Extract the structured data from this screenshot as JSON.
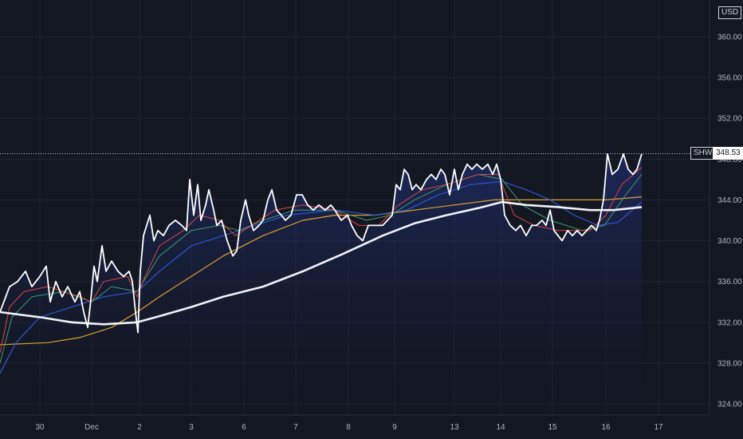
{
  "currency_label": "USD",
  "symbol": "SHW",
  "last_price": "348.53",
  "colors": {
    "background": "#131722",
    "grid": "#1f2433",
    "price_line": "#ffffff",
    "ma_long": "#f0f2f7",
    "ma_gold": "#e0a12e",
    "ma_blue": "#2e56d6",
    "ma_green": "#3f9a73",
    "ma_red": "#d9473c",
    "fill_bottom": "#1a2a63"
  },
  "chart_data": {
    "type": "line",
    "x_ticks": [
      "30",
      "Dec",
      "2",
      "3",
      "6",
      "7",
      "8",
      "9",
      "13",
      "14",
      "15",
      "16",
      "17"
    ],
    "y_ticks": [
      "360.00",
      "356.00",
      "352.00",
      "348.00",
      "344.00",
      "340.00",
      "336.00",
      "332.00",
      "328.00",
      "324.00"
    ],
    "ylim": [
      323,
      363.5
    ],
    "grid": true,
    "series": [
      {
        "role": "price",
        "values": [
          [
            0,
            333.0
          ],
          [
            12,
            335.5
          ],
          [
            22,
            336.0
          ],
          [
            32,
            337.0
          ],
          [
            40,
            335.5
          ],
          [
            50,
            336.5
          ],
          [
            58,
            337.5
          ],
          [
            63,
            334.0
          ],
          [
            70,
            336.0
          ],
          [
            78,
            334.5
          ],
          [
            85,
            335.5
          ],
          [
            94,
            334.0
          ],
          [
            100,
            335.0
          ],
          [
            105,
            333.0
          ],
          [
            110,
            331.5
          ],
          [
            113,
            333.5
          ],
          [
            118,
            337.5
          ],
          [
            122,
            336.0
          ],
          [
            128,
            339.5
          ],
          [
            133,
            337.0
          ],
          [
            140,
            338.0
          ],
          [
            148,
            337.0
          ],
          [
            155,
            336.5
          ],
          [
            162,
            337.0
          ],
          [
            166,
            336.0
          ],
          [
            170,
            333.0
          ],
          [
            173,
            331.0
          ],
          [
            176,
            337.0
          ],
          [
            180,
            340.5
          ],
          [
            184,
            341.5
          ],
          [
            188,
            342.5
          ],
          [
            193,
            340.0
          ],
          [
            198,
            341.0
          ],
          [
            205,
            340.5
          ],
          [
            212,
            341.5
          ],
          [
            220,
            342.0
          ],
          [
            228,
            341.5
          ],
          [
            234,
            341.0
          ],
          [
            238,
            346.0
          ],
          [
            243,
            342.5
          ],
          [
            248,
            345.5
          ],
          [
            252,
            342.0
          ],
          [
            258,
            343.5
          ],
          [
            262,
            345.0
          ],
          [
            268,
            343.0
          ],
          [
            272,
            341.5
          ],
          [
            278,
            342.0
          ],
          [
            285,
            340.0
          ],
          [
            292,
            338.5
          ],
          [
            297,
            339.0
          ],
          [
            302,
            342.0
          ],
          [
            308,
            344.0
          ],
          [
            312,
            342.5
          ],
          [
            318,
            341.0
          ],
          [
            325,
            341.5
          ],
          [
            330,
            342.0
          ],
          [
            336,
            344.0
          ],
          [
            341,
            345.0
          ],
          [
            347,
            343.0
          ],
          [
            353,
            342.5
          ],
          [
            358,
            342.0
          ],
          [
            365,
            342.5
          ],
          [
            372,
            344.5
          ],
          [
            379,
            344.5
          ],
          [
            386,
            343.5
          ],
          [
            393,
            343.0
          ],
          [
            400,
            343.5
          ],
          [
            408,
            343.0
          ],
          [
            415,
            343.5
          ],
          [
            420,
            343.0
          ],
          [
            428,
            342.0
          ],
          [
            436,
            342.5
          ],
          [
            441,
            341.5
          ],
          [
            448,
            340.5
          ],
          [
            455,
            340.0
          ],
          [
            462,
            341.5
          ],
          [
            468,
            341.5
          ],
          [
            474,
            341.5
          ],
          [
            480,
            341.5
          ],
          [
            486,
            342.0
          ],
          [
            492,
            342.5
          ],
          [
            497,
            345.5
          ],
          [
            502,
            345.0
          ],
          [
            507,
            347.0
          ],
          [
            512,
            346.5
          ],
          [
            517,
            345.0
          ],
          [
            522,
            345.5
          ],
          [
            528,
            345.0
          ],
          [
            535,
            346.0
          ],
          [
            541,
            346.5
          ],
          [
            547,
            346.0
          ],
          [
            553,
            347.0
          ],
          [
            558,
            346.5
          ],
          [
            564,
            344.5
          ],
          [
            570,
            347.0
          ],
          [
            575,
            345.0
          ],
          [
            580,
            346.5
          ],
          [
            586,
            347.5
          ],
          [
            592,
            347.0
          ],
          [
            598,
            347.5
          ],
          [
            605,
            347.0
          ],
          [
            612,
            347.5
          ],
          [
            618,
            346.5
          ],
          [
            623,
            347.5
          ],
          [
            628,
            346.0
          ],
          [
            633,
            342.5
          ],
          [
            640,
            341.5
          ],
          [
            647,
            341.0
          ],
          [
            653,
            341.5
          ],
          [
            660,
            340.5
          ],
          [
            667,
            341.5
          ],
          [
            673,
            341.5
          ],
          [
            680,
            342.0
          ],
          [
            685,
            341.5
          ],
          [
            690,
            343.0
          ],
          [
            695,
            341.0
          ],
          [
            700,
            340.5
          ],
          [
            705,
            340.0
          ],
          [
            712,
            341.0
          ],
          [
            718,
            340.5
          ],
          [
            724,
            341.0
          ],
          [
            730,
            340.5
          ],
          [
            736,
            341.0
          ],
          [
            742,
            341.5
          ],
          [
            748,
            341.0
          ],
          [
            752,
            342.0
          ],
          [
            757,
            344.0
          ],
          [
            762,
            348.5
          ],
          [
            768,
            346.5
          ],
          [
            775,
            347.0
          ],
          [
            782,
            348.5
          ],
          [
            788,
            347.0
          ],
          [
            794,
            346.5
          ],
          [
            799,
            347.0
          ],
          [
            805,
            348.53
          ]
        ]
      },
      {
        "role": "ma-red",
        "values": [
          [
            0,
            329.0
          ],
          [
            12,
            333.5
          ],
          [
            30,
            335.0
          ],
          [
            60,
            335.5
          ],
          [
            100,
            334.5
          ],
          [
            115,
            334.0
          ],
          [
            130,
            336.0
          ],
          [
            160,
            336.5
          ],
          [
            172,
            334.5
          ],
          [
            182,
            336.5
          ],
          [
            200,
            339.5
          ],
          [
            230,
            341.0
          ],
          [
            250,
            342.5
          ],
          [
            275,
            342.0
          ],
          [
            295,
            340.5
          ],
          [
            315,
            341.5
          ],
          [
            345,
            343.0
          ],
          [
            380,
            343.5
          ],
          [
            420,
            343.0
          ],
          [
            450,
            341.5
          ],
          [
            475,
            341.5
          ],
          [
            500,
            343.5
          ],
          [
            530,
            345.0
          ],
          [
            560,
            345.5
          ],
          [
            600,
            346.5
          ],
          [
            625,
            346.5
          ],
          [
            645,
            342.5
          ],
          [
            670,
            341.5
          ],
          [
            700,
            341.0
          ],
          [
            740,
            341.0
          ],
          [
            760,
            342.5
          ],
          [
            780,
            345.5
          ],
          [
            805,
            347.2
          ]
        ]
      },
      {
        "role": "ma-green",
        "values": [
          [
            0,
            328.0
          ],
          [
            15,
            332.5
          ],
          [
            40,
            334.5
          ],
          [
            80,
            335.0
          ],
          [
            115,
            334.0
          ],
          [
            140,
            335.5
          ],
          [
            172,
            335.0
          ],
          [
            200,
            338.5
          ],
          [
            240,
            341.0
          ],
          [
            275,
            341.5
          ],
          [
            300,
            341.0
          ],
          [
            330,
            342.0
          ],
          [
            370,
            343.0
          ],
          [
            420,
            343.0
          ],
          [
            460,
            342.0
          ],
          [
            490,
            342.5
          ],
          [
            520,
            344.0
          ],
          [
            560,
            345.5
          ],
          [
            600,
            346.5
          ],
          [
            630,
            346.0
          ],
          [
            655,
            343.5
          ],
          [
            690,
            342.0
          ],
          [
            730,
            341.0
          ],
          [
            758,
            341.5
          ],
          [
            785,
            344.5
          ],
          [
            805,
            346.5
          ]
        ]
      },
      {
        "role": "ma-blue",
        "values": [
          [
            0,
            327.0
          ],
          [
            20,
            330.0
          ],
          [
            50,
            332.5
          ],
          [
            90,
            333.5
          ],
          [
            130,
            334.5
          ],
          [
            172,
            335.0
          ],
          [
            200,
            337.0
          ],
          [
            240,
            339.5
          ],
          [
            280,
            340.5
          ],
          [
            320,
            341.5
          ],
          [
            360,
            342.5
          ],
          [
            420,
            343.0
          ],
          [
            470,
            342.5
          ],
          [
            510,
            343.0
          ],
          [
            550,
            344.5
          ],
          [
            590,
            345.5
          ],
          [
            630,
            345.8
          ],
          [
            660,
            345.0
          ],
          [
            690,
            344.0
          ],
          [
            720,
            342.5
          ],
          [
            750,
            341.5
          ],
          [
            775,
            341.8
          ],
          [
            805,
            343.8
          ]
        ]
      },
      {
        "role": "ma-gold",
        "values": [
          [
            0,
            329.8
          ],
          [
            60,
            330.0
          ],
          [
            100,
            330.5
          ],
          [
            140,
            331.5
          ],
          [
            172,
            333.0
          ],
          [
            200,
            334.5
          ],
          [
            240,
            336.5
          ],
          [
            280,
            338.5
          ],
          [
            330,
            340.5
          ],
          [
            380,
            342.0
          ],
          [
            420,
            342.5
          ],
          [
            470,
            342.5
          ],
          [
            520,
            343.0
          ],
          [
            570,
            343.5
          ],
          [
            620,
            344.0
          ],
          [
            660,
            344.0
          ],
          [
            720,
            344.0
          ],
          [
            760,
            344.0
          ],
          [
            805,
            344.3
          ]
        ]
      },
      {
        "role": "ma-long",
        "values": [
          [
            0,
            333.0
          ],
          [
            50,
            332.5
          ],
          [
            90,
            332.0
          ],
          [
            130,
            331.8
          ],
          [
            172,
            332.0
          ],
          [
            200,
            332.6
          ],
          [
            240,
            333.5
          ],
          [
            280,
            334.5
          ],
          [
            330,
            335.5
          ],
          [
            380,
            337.0
          ],
          [
            430,
            338.7
          ],
          [
            480,
            340.5
          ],
          [
            520,
            341.7
          ],
          [
            560,
            342.5
          ],
          [
            600,
            343.2
          ],
          [
            630,
            343.8
          ],
          [
            660,
            343.5
          ],
          [
            700,
            343.3
          ],
          [
            740,
            343.0
          ],
          [
            770,
            343.0
          ],
          [
            805,
            343.3
          ]
        ]
      }
    ]
  }
}
